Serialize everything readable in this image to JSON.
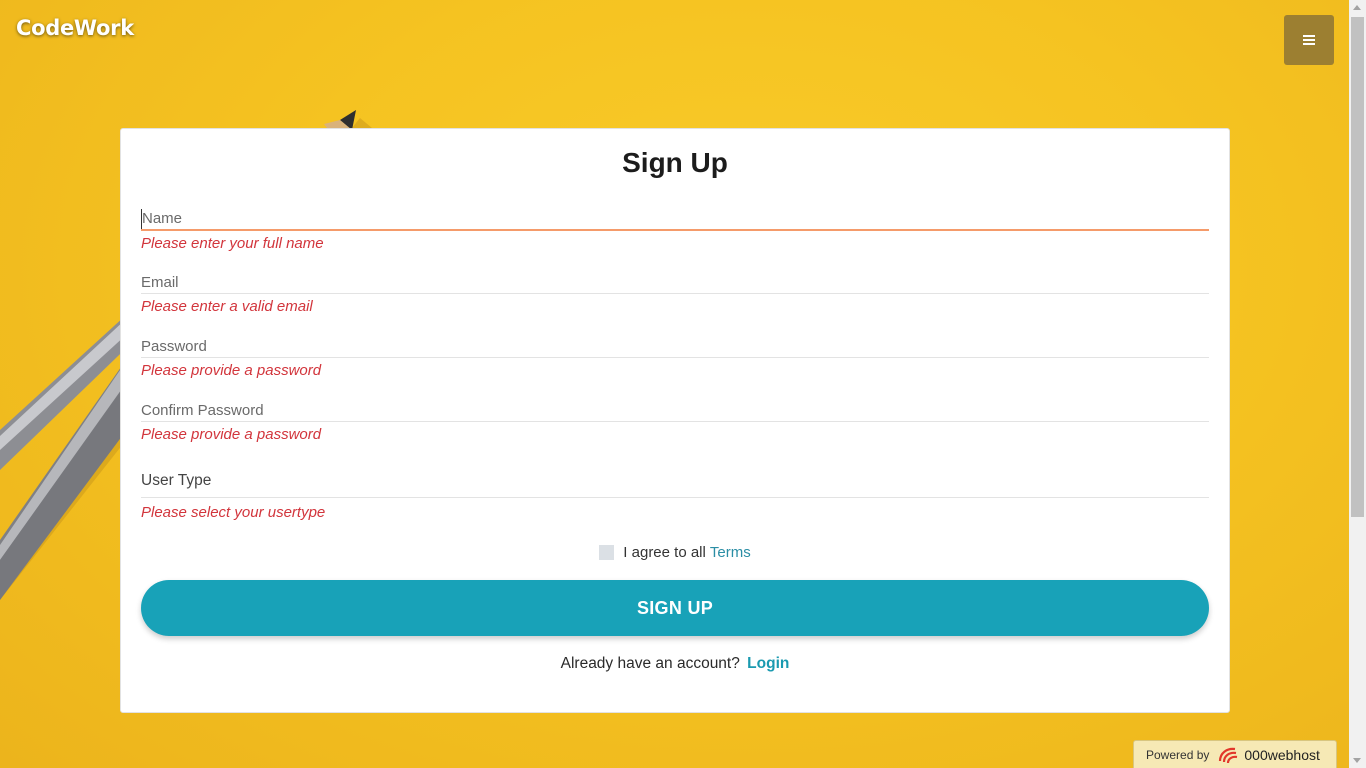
{
  "header": {
    "brand": "CodeWork",
    "menu_icon": "hamburger-menu-icon"
  },
  "form": {
    "title": "Sign Up",
    "fields": [
      {
        "placeholder": "Name",
        "error": "Please enter your full name"
      },
      {
        "placeholder": "Email",
        "error": "Please enter a valid email"
      },
      {
        "placeholder": "Password",
        "error": "Please provide a password"
      },
      {
        "placeholder": "Confirm Password",
        "error": "Please provide a password"
      }
    ],
    "user_type": {
      "label": "User Type",
      "error": "Please select your usertype"
    },
    "terms": {
      "text": "I agree to all",
      "link": "Terms"
    },
    "submit_label": "SIGN UP",
    "login": {
      "text": "Already have an account?",
      "link": "Login"
    }
  },
  "badge": {
    "powered_by": "Powered by",
    "host": "000webhost"
  },
  "colors": {
    "accent": "#18a2b8",
    "error": "#d2353c",
    "background": "#f5c321",
    "menu_button": "#9c7f31"
  }
}
